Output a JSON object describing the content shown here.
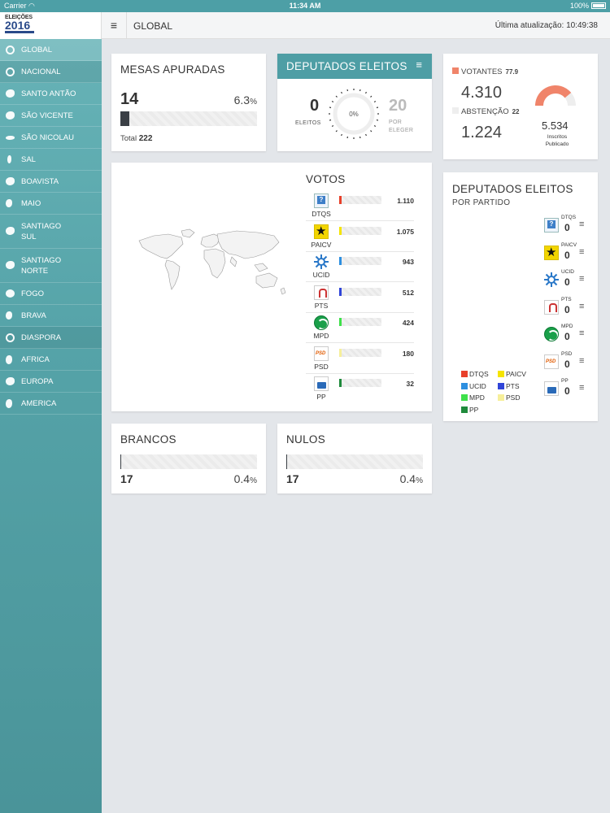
{
  "status_bar": {
    "carrier": "Carrier",
    "time": "11:34 AM",
    "battery": "100%"
  },
  "logo": {
    "line1": "ELEIÇÕES",
    "line2": "2016"
  },
  "header": {
    "title": "GLOBAL",
    "last_update_label": "Última atualização:",
    "last_update_time": "10:49:38"
  },
  "sidebar": {
    "items": [
      {
        "label": "GLOBAL",
        "icon": "globe-icon"
      },
      {
        "label": "NACIONAL",
        "icon": "nacional-icon"
      },
      {
        "label": "SANTO ANTÃO",
        "icon": "island-icon"
      },
      {
        "label": "SÃO VICENTE",
        "icon": "island-icon"
      },
      {
        "label": "SÃO NICOLAU",
        "icon": "island-icon"
      },
      {
        "label": "SAL",
        "icon": "island-icon"
      },
      {
        "label": "BOAVISTA",
        "icon": "island-icon"
      },
      {
        "label": "MAIO",
        "icon": "island-icon"
      },
      {
        "label": "SANTIAGO",
        "label2": "SUL",
        "icon": "island-icon"
      },
      {
        "label": "SANTIAGO",
        "label2": "NORTE",
        "icon": "island-icon"
      },
      {
        "label": "FOGO",
        "icon": "island-icon"
      },
      {
        "label": "BRAVA",
        "icon": "island-icon"
      },
      {
        "label": "DIASPORA",
        "icon": "globe-icon"
      },
      {
        "label": "AFRICA",
        "icon": "continent-icon"
      },
      {
        "label": "EUROPA",
        "icon": "continent-icon"
      },
      {
        "label": "AMERICA",
        "icon": "continent-icon"
      }
    ]
  },
  "mesas": {
    "title": "MESAS APURADAS",
    "count": "14",
    "percent": "6.3",
    "percent_unit": "%",
    "progress": 0.063,
    "total_label": "Total",
    "total": "222"
  },
  "deputados": {
    "title": "DEPUTADOS ELEITOS",
    "eleitos": "0",
    "eleitos_label": "ELEITOS",
    "gauge_pct": "0%",
    "por_eleger": "20",
    "por_eleger_label1": "POR",
    "por_eleger_label2": "ELEGER"
  },
  "votantes": {
    "votantes_label": "VOTANTES",
    "votantes_pct": "77.9",
    "votantes": "4.310",
    "abstencao_label": "ABSTENÇÃO",
    "abstencao_pct": "22",
    "abstencao": "1.224",
    "inscritos": "5.534",
    "inscritos_label1": "Inscritos",
    "inscritos_label2": "Publicado",
    "colors": {
      "votantes": "#f0846a",
      "abstencao": "#eeeeee"
    }
  },
  "votos": {
    "title": "VOTOS",
    "parties": [
      {
        "name": "DTQS",
        "votes": "1.110",
        "value": 1110,
        "color": "#e8402a",
        "logo": "dtqs"
      },
      {
        "name": "PAICV",
        "votes": "1.075",
        "value": 1075,
        "color": "#f5e400",
        "logo": "paicv"
      },
      {
        "name": "UCID",
        "votes": "943",
        "value": 943,
        "color": "#2d8fe0",
        "logo": "ucid"
      },
      {
        "name": "PTS",
        "votes": "512",
        "value": 512,
        "color": "#3045d8",
        "logo": "pts"
      },
      {
        "name": "MPD",
        "votes": "424",
        "value": 424,
        "color": "#3ee04a",
        "logo": "mpd"
      },
      {
        "name": "PSD",
        "votes": "180",
        "value": 180,
        "color": "#f6ef9a",
        "logo": "psd"
      },
      {
        "name": "PP",
        "votes": "32",
        "value": 32,
        "color": "#1f8a3c",
        "logo": "pp"
      }
    ]
  },
  "dep_partido": {
    "title": "DEPUTADOS ELEITOS",
    "subtitle": "POR PARTIDO",
    "rows": [
      {
        "name": "DTQS",
        "count": "0",
        "logo": "dtqs"
      },
      {
        "name": "PAICV",
        "count": "0",
        "logo": "paicv"
      },
      {
        "name": "UCID",
        "count": "0",
        "logo": "ucid"
      },
      {
        "name": "PTS",
        "count": "0",
        "logo": "pts"
      },
      {
        "name": "MPD",
        "count": "0",
        "logo": "mpd"
      },
      {
        "name": "PSD",
        "count": "0",
        "logo": "psd"
      },
      {
        "name": "PP",
        "count": "0",
        "logo": "pp"
      }
    ],
    "legend": [
      {
        "name": "DTQS",
        "color": "#e8402a"
      },
      {
        "name": "PAICV",
        "color": "#f5e400"
      },
      {
        "name": "UCID",
        "color": "#2d8fe0"
      },
      {
        "name": "PTS",
        "color": "#3045d8"
      },
      {
        "name": "MPD",
        "color": "#3ee04a"
      },
      {
        "name": "PSD",
        "color": "#f6ef9a"
      },
      {
        "name": "PP",
        "color": "#1f8a3c"
      }
    ]
  },
  "brancos": {
    "title": "BRANCOS",
    "count": "17",
    "percent": "0.4",
    "percent_unit": "%",
    "progress": 0.004
  },
  "nulos": {
    "title": "NULOS",
    "count": "17",
    "percent": "0.4",
    "percent_unit": "%",
    "progress": 0.004
  }
}
